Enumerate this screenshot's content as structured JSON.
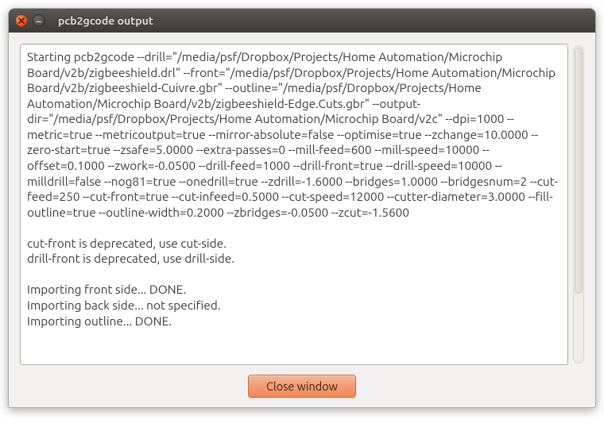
{
  "window": {
    "title": "pcb2gcode output"
  },
  "output": {
    "text": "Starting pcb2gcode --drill=\"/media/psf/Dropbox/Projects/Home Automation/Microchip Board/v2b/zigbeeshield.drl\" --front=\"/media/psf/Dropbox/Projects/Home Automation/Microchip Board/v2b/zigbeeshield-Cuivre.gbr\" --outline=\"/media/psf/Dropbox/Projects/Home Automation/Microchip Board/v2b/zigbeeshield-Edge.Cuts.gbr\" --output-dir=\"/media/psf/Dropbox/Projects/Home Automation/Microchip Board/v2c\" --dpi=1000 --metric=true --metricoutput=true --mirror-absolute=false --optimise=true --zchange=10.0000 --zero-start=true --zsafe=5.0000 --extra-passes=0 --mill-feed=600 --mill-speed=10000 --offset=0.1000 --zwork=-0.0500 --drill-feed=1000 --drill-front=true --drill-speed=10000 --milldrill=false --nog81=true --onedrill=true --zdrill=-1.6000 --bridges=1.0000 --bridgesnum=2 --cut-feed=250 --cut-front=true --cut-infeed=0.5000 --cut-speed=12000 --cutter-diameter=3.0000 --fill-outline=true --outline-width=0.2000 --zbridges=-0.0500 --zcut=-1.5600\n\ncut-front is deprecated, use cut-side.\ndrill-front is deprecated, use drill-side.\n\nImporting front side... DONE.\nImporting back side... not specified.\nImporting outline... DONE."
  },
  "buttons": {
    "close_window": "Close window"
  }
}
